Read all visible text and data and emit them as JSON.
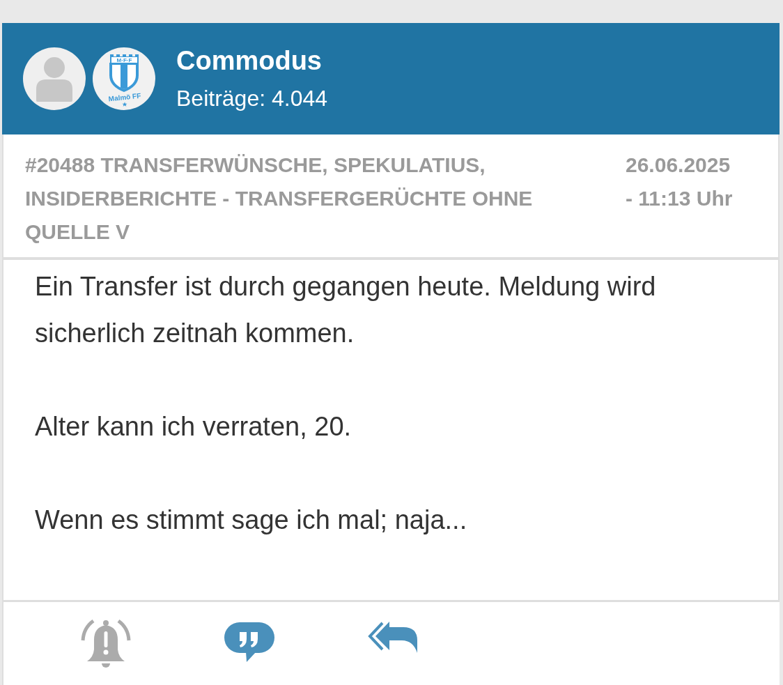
{
  "user": {
    "name": "Commodus",
    "post_count": "Beiträge: 4.044",
    "club_logo": {
      "top_text": "M·F·F",
      "bottom_text": "Malmö FF"
    }
  },
  "thread": {
    "title": "#20488 TRANSFERWÜNSCHE, SPEKULATIUS, INSIDERBERICHTE - TRANSFERGERÜCHTE OHNE QUELLE V",
    "date": "26.06.2025 - 11:13 Uhr"
  },
  "post": {
    "paragraphs": [
      "Ein Transfer ist durch gegangen heute. Meldung wird sicherlich zeitnah kommen.",
      "Alter kann ich verraten, 20.",
      "Wenn es stimmt sage ich mal; naja..."
    ]
  },
  "actions": [
    {
      "kind": "alert",
      "active": false
    },
    {
      "kind": "quote",
      "active": true
    },
    {
      "kind": "reply",
      "active": true
    }
  ]
}
